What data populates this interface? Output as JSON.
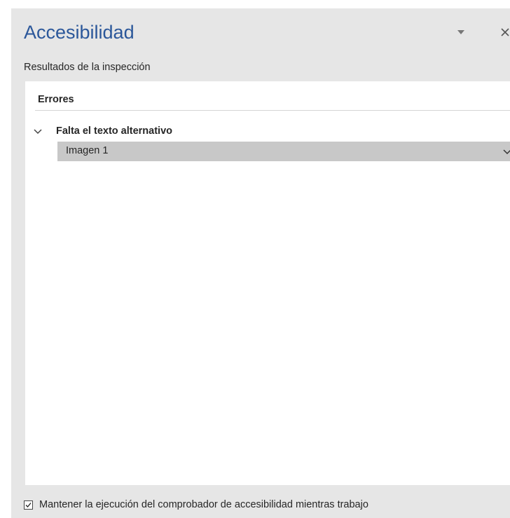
{
  "pane": {
    "title": "Accesibilidad",
    "options_icon": "caret-down-icon",
    "close_icon": "close-icon",
    "subtitle": "Resultados de la inspección"
  },
  "results": {
    "section_header": "Errores",
    "issues": [
      {
        "title": "Falta el texto alternativo",
        "expanded": true,
        "items": [
          {
            "label": "Imagen 1",
            "selected": true
          }
        ]
      }
    ]
  },
  "footer": {
    "keep_running_label": "Mantener la ejecución del comprobador de accesibilidad mientras trabajo",
    "keep_running_checked": true
  },
  "colors": {
    "title_accent": "#2b579a",
    "pane_background": "#e6e6e6",
    "selected_item_background": "#c8c8c8",
    "text": "#262626"
  }
}
